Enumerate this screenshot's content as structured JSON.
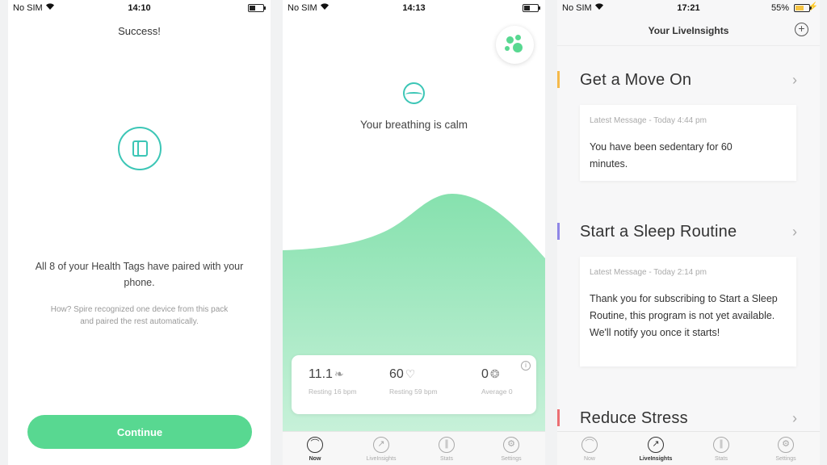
{
  "screen1": {
    "status": {
      "carrier": "No SIM",
      "time": "14:10"
    },
    "title": "Success!",
    "message": "All 8 of your Health Tags have paired with your phone.",
    "sub": "How? Spire recognized one device from this pack and paired the rest automatically.",
    "continue_label": "Continue"
  },
  "screen2": {
    "status": {
      "carrier": "No SIM",
      "time": "14:13"
    },
    "state": "Your breathing is calm",
    "metrics": [
      {
        "value": "11.1",
        "sub": "Resting 16 bpm"
      },
      {
        "value": "60",
        "sub": "Resting 59 bpm"
      },
      {
        "value": "0",
        "sub": "Average 0"
      }
    ],
    "wave_color": "#86e1ae",
    "tabs": [
      {
        "label": "Now",
        "icon": "now-icon"
      },
      {
        "label": "LiveInsights",
        "icon": "insights-icon"
      },
      {
        "label": "Stats",
        "icon": "stats-icon"
      },
      {
        "label": "Settings",
        "icon": "settings-icon"
      }
    ]
  },
  "screen3": {
    "status": {
      "carrier": "No SIM",
      "time": "17:21",
      "battery": "55%"
    },
    "title": "Your LiveInsights",
    "sections": [
      {
        "title": "Get a Move On",
        "color": "#f5b94a",
        "head": "Latest Message - Today 4:44 pm",
        "body": "You have been sedentary for 60 minutes."
      },
      {
        "title": "Start a Sleep Routine",
        "color": "#8f86e6",
        "head": "Latest Message - Today 2:14 pm",
        "body": "Thank you for subscribing to Start a Sleep Routine, this program is not yet available. We'll notify you once it starts!"
      },
      {
        "title": "Reduce Stress",
        "color": "#ec6f73"
      }
    ],
    "tabs": [
      {
        "label": "Now"
      },
      {
        "label": "LiveInsights"
      },
      {
        "label": "Stats"
      },
      {
        "label": "Settings"
      }
    ]
  },
  "colors": {
    "accent_green": "#58d891",
    "teal": "#3cc6b6"
  }
}
